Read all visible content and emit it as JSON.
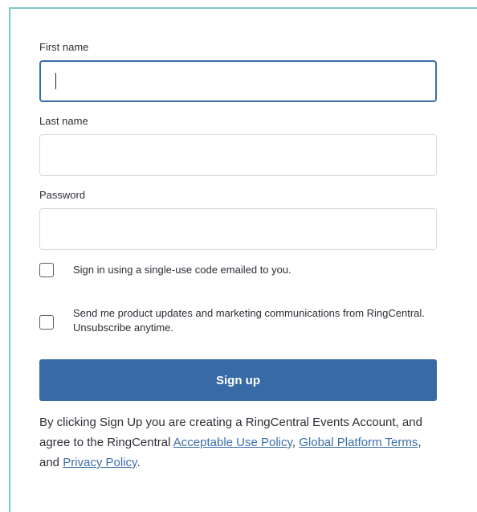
{
  "form": {
    "first_name": {
      "label": "First name",
      "value": ""
    },
    "last_name": {
      "label": "Last name",
      "value": ""
    },
    "password": {
      "label": "Password",
      "value": ""
    },
    "single_use_code": {
      "label": "Sign in using a single-use code emailed to you.",
      "checked": false
    },
    "marketing_opt_in": {
      "label": "Send me product updates and marketing communications from RingCentral. Unsubscribe anytime.",
      "checked": false
    },
    "submit_label": "Sign up"
  },
  "legal": {
    "prefix": "By clicking Sign Up you are creating a RingCentral Events Account, and agree to the RingCentral ",
    "acceptable_use_link": "Acceptable Use Policy",
    "sep1": ", ",
    "global_terms_link": "Global Platform Terms",
    "sep2": ", and ",
    "privacy_link": "Privacy Policy",
    "suffix": "."
  },
  "colors": {
    "accent": "#386ba6",
    "frame_border": "#7cc9c9",
    "link": "#3b6ea8"
  }
}
